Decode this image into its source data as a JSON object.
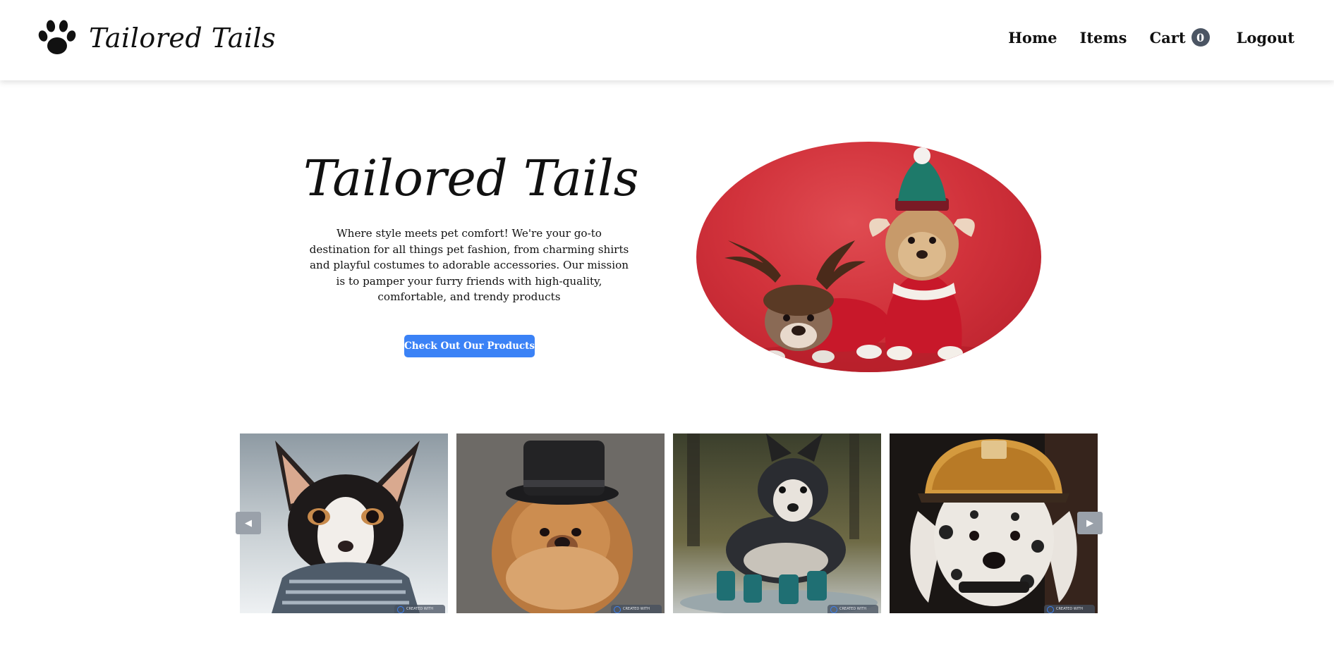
{
  "header": {
    "brand": "Tailored Tails",
    "brand_icon": "paw-icon",
    "nav": {
      "home": "Home",
      "items": "Items",
      "cart": "Cart",
      "cart_count": "0",
      "logout": "Logout"
    }
  },
  "hero": {
    "title": "Tailored Tails",
    "description": "Where style meets pet comfort! We're your go-to destination for all things pet fashion, from charming shirts and playful costumes to adorable accessories. Our mission is to pamper your furry friends with high-quality, comfortable, and trendy products",
    "cta_label": "Check Out Our Products",
    "image_subject": "two dogs in christmas costumes on red background"
  },
  "carousel": {
    "prev_icon": "◀",
    "next_icon": "▶",
    "slides": [
      {
        "subject": "chihuahua wearing striped scarf",
        "badge": "CREATED WITH"
      },
      {
        "subject": "chow chow puppy wearing top hat",
        "badge": "CREATED WITH"
      },
      {
        "subject": "husky puppy wearing teal rain boots",
        "badge": "CREATED WITH"
      },
      {
        "subject": "dalmatian wearing firefighter helmet",
        "badge": "CREATED WITH"
      }
    ]
  },
  "colors": {
    "accent": "#3b82f6",
    "badge": "#4b5563",
    "text": "#111111",
    "arrow": "#9aa1aa"
  }
}
